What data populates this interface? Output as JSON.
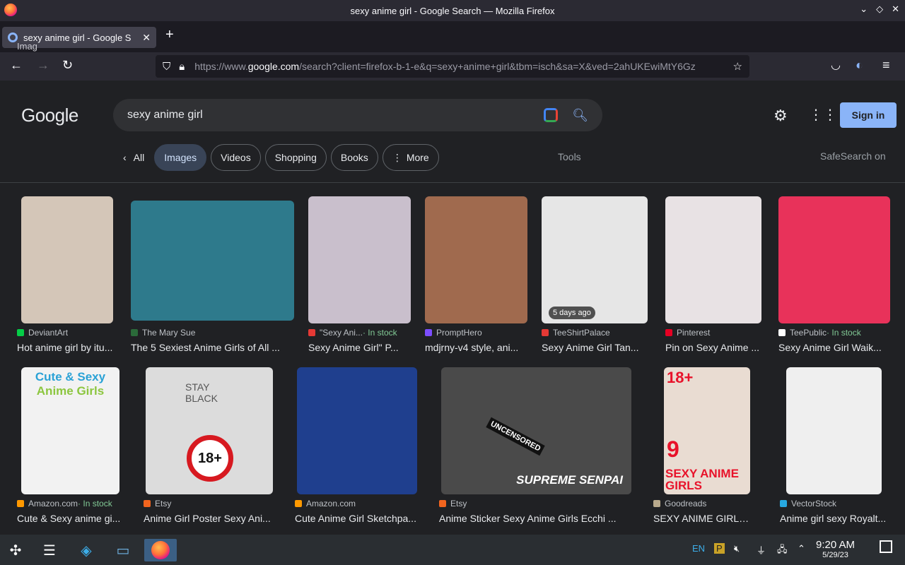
{
  "window": {
    "title": "sexy anime girl - Google Search — Mozilla Firefox",
    "controls": [
      "⌄",
      "◇",
      "✕"
    ]
  },
  "tabs": [
    {
      "label": "sexy anime girl - Google S",
      "tooltip": "Imag"
    }
  ],
  "nav": {
    "url_prefix": "https://www.",
    "url_host": "google.com",
    "url_rest": "/search?client=firefox-b-1-e&q=sexy+anime+girl&tbm=isch&sa=X&ved=2ahUKEwiMtY6Gz"
  },
  "google": {
    "logo": "Google",
    "query": "sexy anime girl",
    "signin": "Sign in",
    "chips": [
      "All",
      "Images",
      "Videos",
      "Shopping",
      "Books",
      "More"
    ],
    "tools": "Tools",
    "safesearch": "SafeSearch on"
  },
  "results": [
    {
      "source": "DeviantArt",
      "stock": "",
      "title": "Hot anime girl by itu...",
      "badge": "",
      "color": "#d4c6b8",
      "icon_color": "#05cc47"
    },
    {
      "source": "The Mary Sue",
      "stock": "",
      "title": "The 5 Sexiest Anime Girls of All ...",
      "badge": "",
      "color": "#2e7a8c",
      "icon_color": "#2b6b3a"
    },
    {
      "source": "\"Sexy Ani...",
      "stock": "In stock",
      "title": "Sexy Anime Girl\" P...",
      "badge": "",
      "color": "#c9bfcc",
      "icon_color": "#e53935"
    },
    {
      "source": "PromptHero",
      "stock": "",
      "title": "mdjrny-v4 style, ani...",
      "badge": "",
      "color": "#a06a4e",
      "icon_color": "#7c4dff"
    },
    {
      "source": "TeeShirtPalace",
      "stock": "",
      "title": "Sexy Anime Girl Tan...",
      "badge": "5 days ago",
      "color": "#e6e6e6",
      "icon_color": "#e53935"
    },
    {
      "source": "Pinterest",
      "stock": "",
      "title": "Pin on Sexy Anime ...",
      "badge": "",
      "color": "#e8e2e4",
      "icon_color": "#e60023"
    },
    {
      "source": "TeePublic",
      "stock": "In stock",
      "title": "Sexy Anime Girl Waik...",
      "badge": "",
      "color": "#e8325a",
      "icon_color": "#ffffff"
    },
    {
      "source": "Amazon.com",
      "stock": "In stock",
      "title": "Cute & Sexy anime gi...",
      "badge": "",
      "color": "#f2f2f2",
      "icon_color": "#ff9900"
    },
    {
      "source": "Etsy",
      "stock": "",
      "title": "Anime Girl Poster Sexy Ani...",
      "badge": "",
      "color": "#dcdcdc",
      "icon_color": "#f1641e"
    },
    {
      "source": "Amazon.com",
      "stock": "",
      "title": "Cute Anime Girl Sketchpa...",
      "badge": "",
      "color": "#1f3f8e",
      "icon_color": "#ff9900"
    },
    {
      "source": "Etsy",
      "stock": "",
      "title": "Anime Sticker Sexy Anime Girls Ecchi ...",
      "badge": "",
      "color": "#4a4a4a",
      "icon_color": "#f1641e"
    },
    {
      "source": "Goodreads",
      "stock": "",
      "title": "SEXY ANIME GIRLS ...",
      "badge": "",
      "color": "#e9dcd2",
      "icon_color": "#b8a98c"
    },
    {
      "source": "VectorStock",
      "stock": "",
      "title": "Anime girl sexy Royalt...",
      "badge": "",
      "color": "#efefef",
      "icon_color": "#27a8e0"
    }
  ],
  "image_text": {
    "r7_top": "Cute & Sexy",
    "r7_bottom": "Anime Girls",
    "r8_sign": "18+",
    "r8_stay": "STAY BLACK",
    "r10_uncensored": "UNCENSORED",
    "r10_brand": "SUPREME SENPAI",
    "r11_top": "18+",
    "r11_num": "9",
    "r11_text": "SEXY ANIME GIRLS"
  },
  "taskbar": {
    "lang": "EN",
    "time": "9:20 AM",
    "date": "5/29/23"
  }
}
